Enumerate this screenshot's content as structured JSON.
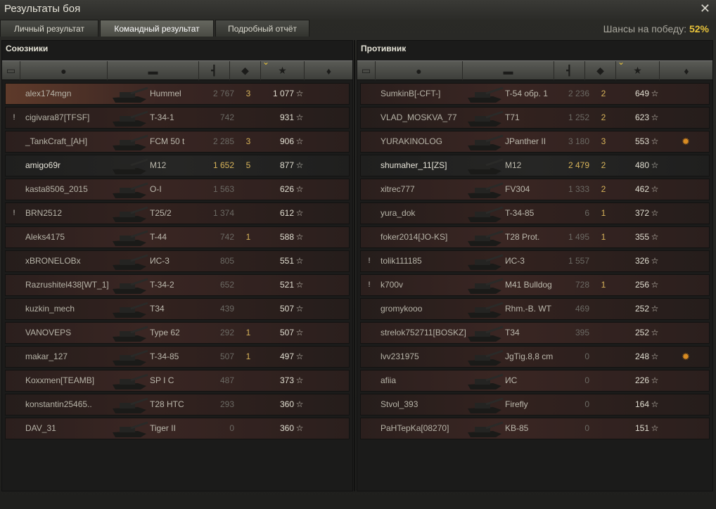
{
  "window": {
    "title": "Результаты боя",
    "close_icon": "close-icon"
  },
  "tabs": [
    {
      "label": "Личный результат",
      "active": false
    },
    {
      "label": "Командный результат",
      "active": true
    },
    {
      "label": "Подробный отчёт",
      "active": false
    }
  ],
  "win_chance": {
    "label": "Шансы на победу:",
    "value": "52%"
  },
  "colors": {
    "accent": "#e8c33a",
    "damage_highlight": "#d8b45a",
    "row_red": "#3a2623"
  },
  "columns": [
    "squad-icon",
    "player-icon",
    "tank-icon",
    "damage-icon",
    "kills-icon",
    "xp-star-icon",
    "medal-icon"
  ],
  "allies": {
    "title": "Союзники",
    "rows": [
      {
        "badge": "",
        "name": "alex174mgn",
        "tank": "Hummel",
        "damage": "2 767",
        "kills": "3",
        "xp": "1 077",
        "medal": "",
        "style": "self"
      },
      {
        "badge": "!",
        "name": "cigivara87[TFSF]",
        "tank": "T-34-1",
        "damage": "742",
        "kills": "",
        "xp": "931",
        "medal": "",
        "style": "red"
      },
      {
        "badge": "",
        "name": "_TankCraft_[AH]",
        "tank": "FCM 50 t",
        "damage": "2 285",
        "kills": "3",
        "xp": "906",
        "medal": "",
        "style": "red"
      },
      {
        "badge": "",
        "name": "amigo69r",
        "tank": "M12",
        "damage": "1 652",
        "damage_hi": true,
        "kills": "5",
        "xp": "877",
        "medal": "",
        "style": "plain"
      },
      {
        "badge": "",
        "name": "kasta8506_2015",
        "tank": "O-I",
        "damage": "1 563",
        "kills": "",
        "xp": "626",
        "medal": "",
        "style": "red"
      },
      {
        "badge": "!",
        "name": "BRN2512",
        "tank": "T25/2",
        "damage": "1 374",
        "kills": "",
        "xp": "612",
        "medal": "",
        "style": "red"
      },
      {
        "badge": "",
        "name": "Aleks4175",
        "tank": "T-44",
        "damage": "742",
        "kills": "1",
        "xp": "588",
        "medal": "",
        "style": "red"
      },
      {
        "badge": "",
        "name": "xBRONELOBx",
        "tank": "ИС-3",
        "damage": "805",
        "kills": "",
        "xp": "551",
        "medal": "",
        "style": "red"
      },
      {
        "badge": "",
        "name": "Razrushitel438[WT_1]",
        "tank": "T-34-2",
        "damage": "652",
        "kills": "",
        "xp": "521",
        "medal": "",
        "style": "red"
      },
      {
        "badge": "",
        "name": "kuzkin_mech",
        "tank": "T34",
        "damage": "439",
        "kills": "",
        "xp": "507",
        "medal": "",
        "style": "red"
      },
      {
        "badge": "",
        "name": "VANOVEPS",
        "tank": "Type 62",
        "damage": "292",
        "kills": "1",
        "xp": "507",
        "medal": "",
        "style": "red"
      },
      {
        "badge": "",
        "name": "makar_127",
        "tank": "T-34-85",
        "damage": "507",
        "kills": "1",
        "xp": "497",
        "medal": "",
        "style": "red"
      },
      {
        "badge": "",
        "name": "Koxxmen[TEAMB]",
        "tank": "SP I C",
        "damage": "487",
        "kills": "",
        "xp": "373",
        "medal": "",
        "style": "red"
      },
      {
        "badge": "",
        "name": "konstantin25465..",
        "tank": "T28 HTC",
        "damage": "293",
        "kills": "",
        "xp": "360",
        "medal": "",
        "style": "red"
      },
      {
        "badge": "",
        "name": "DAV_31",
        "tank": "Tiger II",
        "damage": "0",
        "kills": "",
        "xp": "360",
        "medal": "",
        "style": "red"
      }
    ]
  },
  "enemies": {
    "title": "Противник",
    "rows": [
      {
        "badge": "",
        "name": "SumkinB[-CFT-]",
        "tank": "T-54 обр. 1",
        "damage": "2 236",
        "kills": "2",
        "xp": "649",
        "medal": "",
        "style": "red"
      },
      {
        "badge": "",
        "name": "VLAD_MOSKVA_77",
        "tank": "T71",
        "damage": "1 252",
        "kills": "2",
        "xp": "623",
        "medal": "",
        "style": "red"
      },
      {
        "badge": "",
        "name": "YURAKINOLOG",
        "tank": "JPanther II",
        "damage": "3 180",
        "kills": "3",
        "xp": "553",
        "medal": "✹",
        "style": "red"
      },
      {
        "badge": "",
        "name": "shumaher_11[ZS]",
        "tank": "M12",
        "damage": "2 479",
        "damage_hi": true,
        "kills": "2",
        "xp": "480",
        "medal": "",
        "style": "plain"
      },
      {
        "badge": "",
        "name": "xitrec777",
        "tank": "FV304",
        "damage": "1 333",
        "kills": "2",
        "xp": "462",
        "medal": "",
        "style": "red"
      },
      {
        "badge": "",
        "name": "yura_dok",
        "tank": "T-34-85",
        "damage": "6",
        "kills": "1",
        "xp": "372",
        "medal": "",
        "style": "red"
      },
      {
        "badge": "",
        "name": "foker2014[JO-KS]",
        "tank": "T28 Prot.",
        "damage": "1 495",
        "kills": "1",
        "xp": "355",
        "medal": "",
        "style": "red"
      },
      {
        "badge": "!",
        "name": "tolik111185",
        "tank": "ИС-3",
        "damage": "1 557",
        "kills": "",
        "xp": "326",
        "medal": "",
        "style": "red"
      },
      {
        "badge": "!",
        "name": "k700v",
        "tank": "M41 Bulldog",
        "damage": "728",
        "kills": "1",
        "xp": "256",
        "medal": "",
        "style": "red"
      },
      {
        "badge": "",
        "name": "gromykooo",
        "tank": "Rhm.-B. WT",
        "damage": "469",
        "kills": "",
        "xp": "252",
        "medal": "",
        "style": "red"
      },
      {
        "badge": "",
        "name": "strelok752711[BOSKZ]",
        "tank": "T34",
        "damage": "395",
        "kills": "",
        "xp": "252",
        "medal": "",
        "style": "red"
      },
      {
        "badge": "",
        "name": "lvv231975",
        "tank": "JgTig.8,8 cm",
        "damage": "0",
        "kills": "",
        "xp": "248",
        "medal": "✹",
        "style": "red"
      },
      {
        "badge": "",
        "name": "afiia",
        "tank": "ИС",
        "damage": "0",
        "kills": "",
        "xp": "226",
        "medal": "",
        "style": "red"
      },
      {
        "badge": "",
        "name": "Stvol_393",
        "tank": "Firefly",
        "damage": "0",
        "kills": "",
        "xp": "164",
        "medal": "",
        "style": "red"
      },
      {
        "badge": "",
        "name": "PaHTepKa[08270]",
        "tank": "KB-85",
        "damage": "0",
        "kills": "",
        "xp": "151",
        "medal": "",
        "style": "red"
      }
    ]
  }
}
